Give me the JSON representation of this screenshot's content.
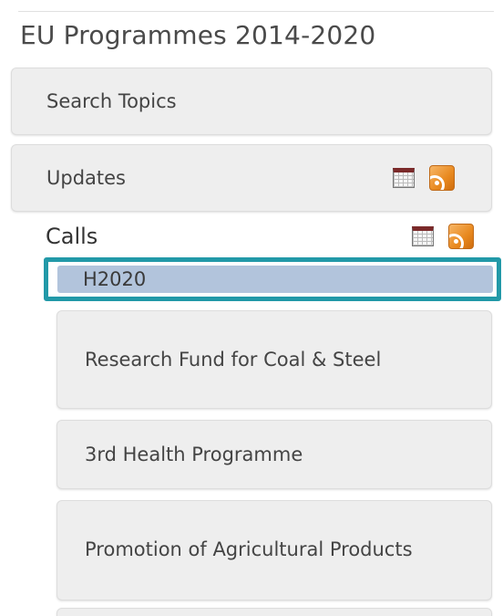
{
  "panel": {
    "title": "EU Programmes 2014-2020"
  },
  "menu": {
    "search_label": "Search Topics",
    "updates_label": "Updates",
    "calls_label": "Calls",
    "calls_items": [
      "H2020",
      "Research Fund for Coal & Steel",
      "3rd Health Programme",
      "Promotion of Agricultural Products"
    ]
  },
  "icons": {
    "calendar": "calendar-icon",
    "rss": "rss-feed-icon"
  },
  "colors": {
    "selected_bg": "#b2c4dc",
    "highlight_border": "#2299a8",
    "item_bg": "#eeeeee",
    "rss": "#e8891f"
  }
}
